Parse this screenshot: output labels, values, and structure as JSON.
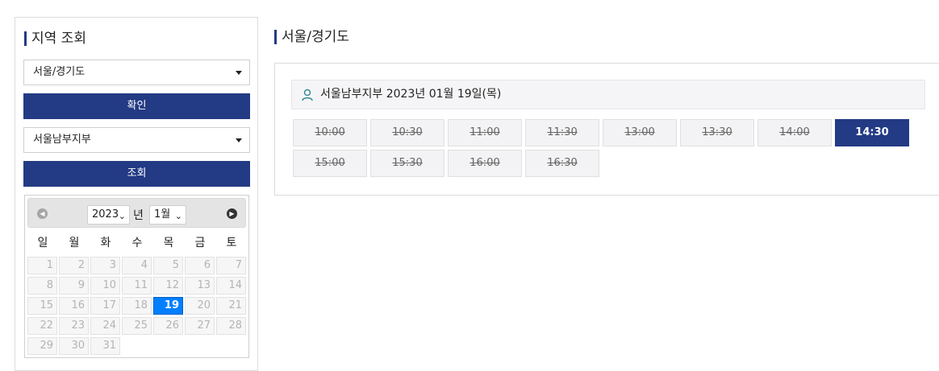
{
  "left": {
    "title": "지역 조회",
    "region_select": "서울/경기도",
    "confirm_button": "확인",
    "branch_select": "서울남부지부",
    "search_button": "조회"
  },
  "calendar": {
    "year": "2023",
    "year_suffix": "년",
    "month": "1월",
    "weekdays": [
      "일",
      "월",
      "화",
      "수",
      "목",
      "금",
      "토"
    ],
    "days": [
      "1",
      "2",
      "3",
      "4",
      "5",
      "6",
      "7",
      "8",
      "9",
      "10",
      "11",
      "12",
      "13",
      "14",
      "15",
      "16",
      "17",
      "18",
      "19",
      "20",
      "21",
      "22",
      "23",
      "24",
      "25",
      "26",
      "27",
      "28",
      "29",
      "30",
      "31"
    ],
    "selected_day": "19"
  },
  "right": {
    "title": "서울/경기도",
    "info": "서울남부지부 2023년 01월 19일(목)",
    "slots": [
      {
        "time": "10:00",
        "available": false
      },
      {
        "time": "10:30",
        "available": false
      },
      {
        "time": "11:00",
        "available": false
      },
      {
        "time": "11:30",
        "available": false
      },
      {
        "time": "13:00",
        "available": false
      },
      {
        "time": "13:30",
        "available": false
      },
      {
        "time": "14:00",
        "available": false
      },
      {
        "time": "14:30",
        "available": true
      },
      {
        "time": "15:00",
        "available": false
      },
      {
        "time": "15:30",
        "available": false
      },
      {
        "time": "16:00",
        "available": false
      },
      {
        "time": "16:30",
        "available": false
      }
    ]
  },
  "colors": {
    "accent": "#233a84",
    "selected_day": "#007fff"
  }
}
